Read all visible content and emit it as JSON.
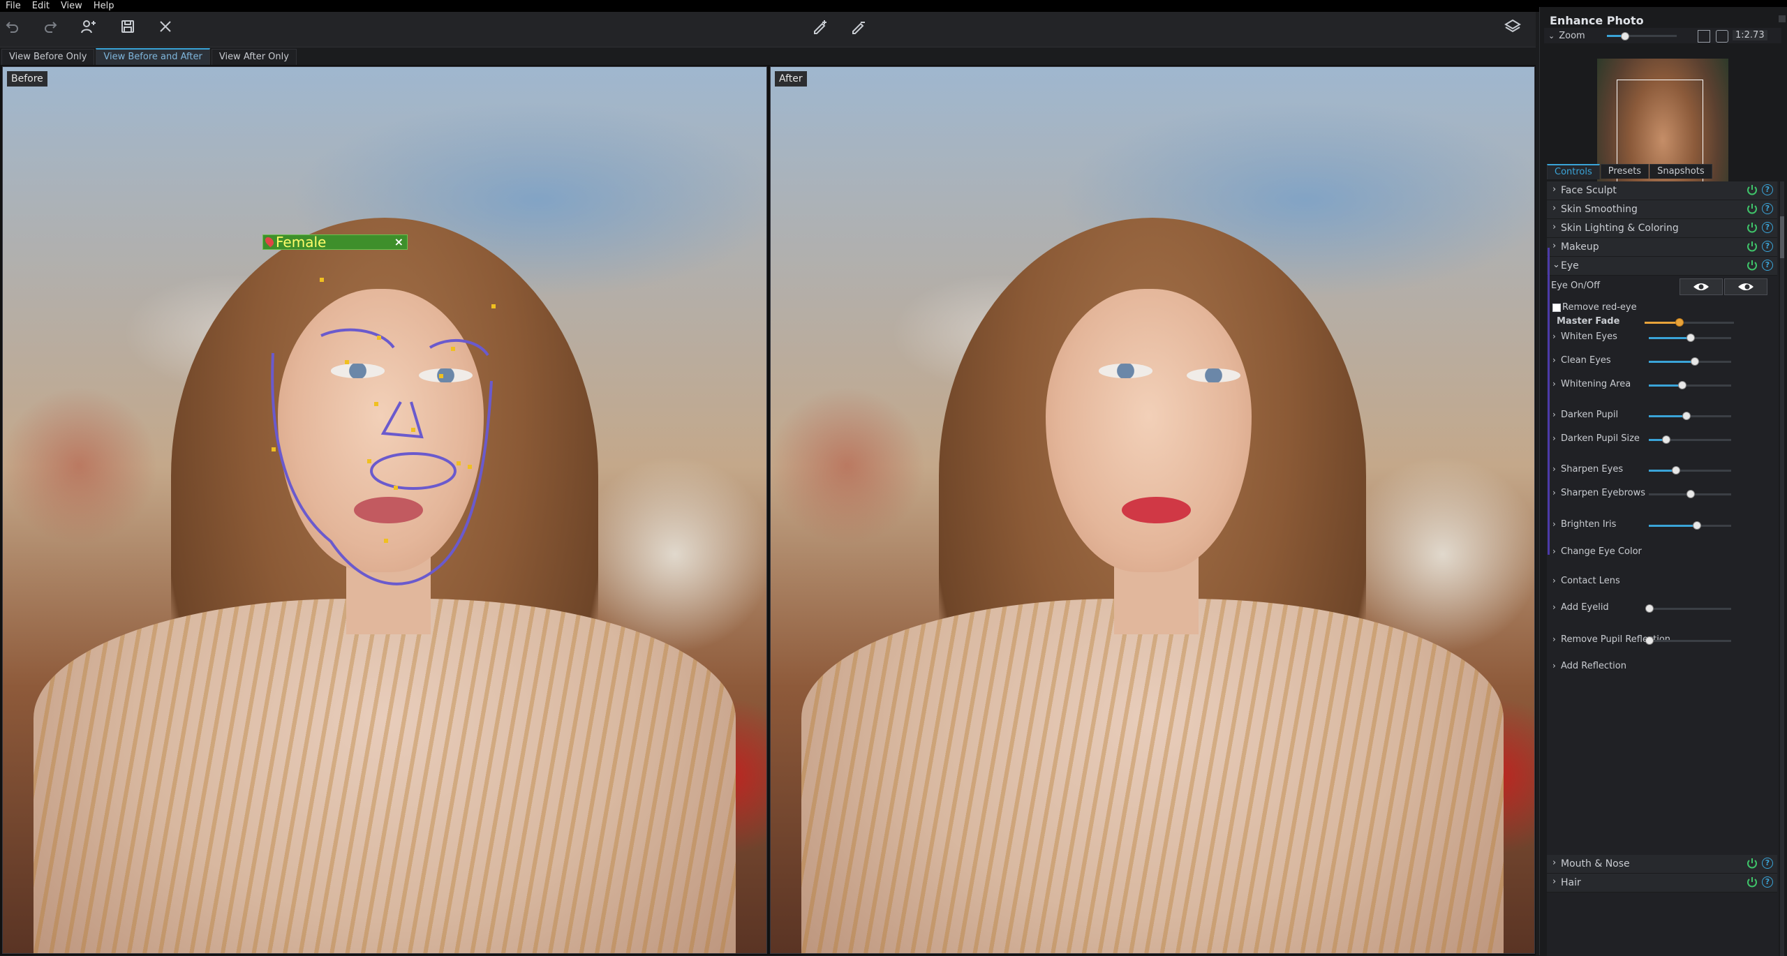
{
  "menu": {
    "items": [
      "File",
      "Edit",
      "View",
      "Help"
    ]
  },
  "toolbar": {
    "icons": [
      "undo-icon",
      "redo-icon",
      "add-face-icon",
      "save-icon",
      "close-icon",
      "pen-add-icon",
      "pen-remove-icon",
      "layers-icon"
    ]
  },
  "view_tabs": {
    "before_only": "View Before Only",
    "before_and_after": "View Before and After",
    "after_only": "View After Only",
    "active": "View Before and After"
  },
  "canvas": {
    "before_label": "Before",
    "after_label": "After",
    "face_tag": "Female"
  },
  "panel": {
    "title": "Enhance Photo",
    "zoom_label": "Zoom",
    "zoom_value": "1:2.73",
    "zoom_level": 0.25,
    "tabs": [
      "Controls",
      "Presets",
      "Snapshots"
    ],
    "active_tab": "Controls",
    "sections_top": [
      "Face Sculpt",
      "Skin Smoothing",
      "Skin Lighting & Coloring",
      "Makeup"
    ],
    "eye": {
      "section": "Eye",
      "onoff_label": "Eye On/Off",
      "red_eye_label": "Remove red-eye",
      "red_eye_checked": false,
      "master_fade_label": "Master Fade",
      "master_fade": 0.45,
      "sliders": [
        {
          "label": "Whiten Eyes",
          "value": 0.5,
          "filled": true
        },
        {
          "label": "Clean Eyes",
          "value": 0.55,
          "filled": true
        },
        {
          "label": "Whitening Area",
          "value": 0.4,
          "filled": true
        },
        {
          "label": "Darken Pupil",
          "value": 0.45,
          "filled": true
        },
        {
          "label": "Darken Pupil Size",
          "value": 0.2,
          "filled": true
        },
        {
          "label": "Sharpen Eyes",
          "value": 0.32,
          "filled": true
        },
        {
          "label": "Sharpen Eyebrows",
          "value": 0.5,
          "filled": false
        },
        {
          "label": "Brighten Iris",
          "value": 0.58,
          "filled": true
        },
        {
          "label": "Change Eye Color",
          "value": null,
          "filled": false
        },
        {
          "label": "Contact Lens",
          "value": null,
          "filled": false
        },
        {
          "label": "Add Eyelid",
          "value": 0.0,
          "filled": false
        },
        {
          "label": "Remove Pupil Reflection",
          "value": 0.0,
          "filled": false
        },
        {
          "label": "Add Reflection",
          "value": null,
          "filled": false
        }
      ]
    },
    "sections_bottom": [
      "Mouth & Nose",
      "Hair"
    ],
    "help_glyph": "?"
  },
  "colors": {
    "accent": "#3aa4d8",
    "power": "#3fc46a",
    "tag_green": "#3e8f2b",
    "tag_text": "#fffc6a"
  }
}
